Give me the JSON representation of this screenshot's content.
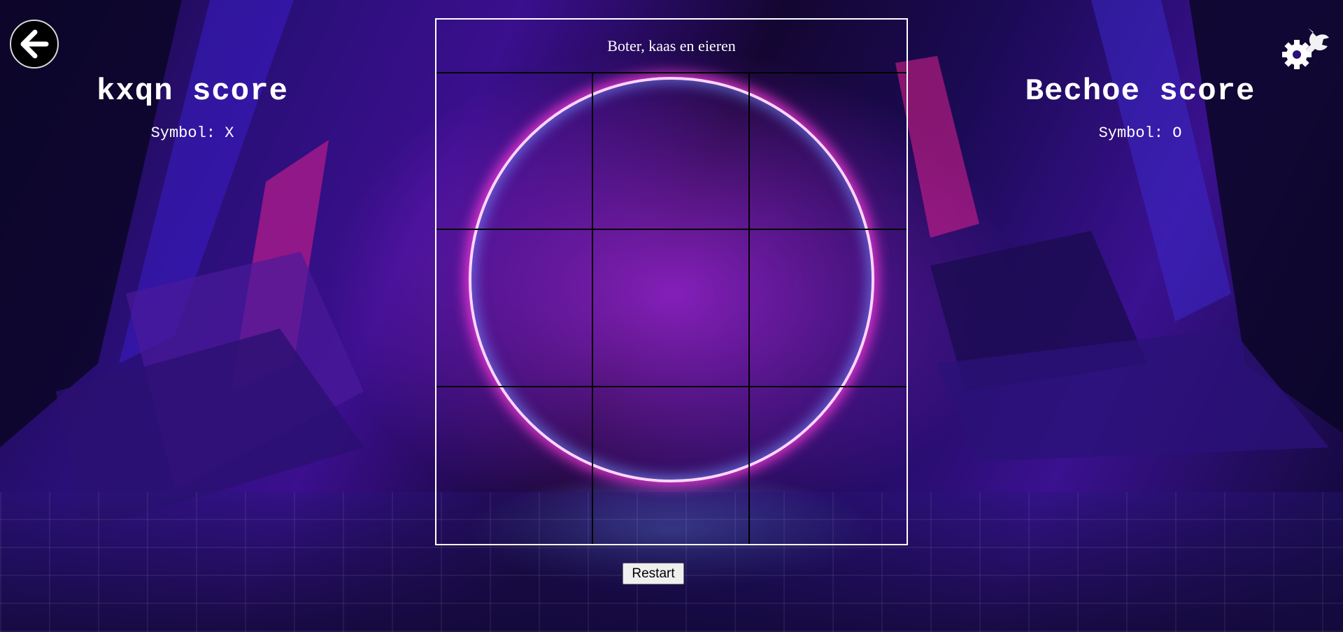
{
  "board": {
    "title": "Boter, kaas en eieren",
    "cells": [
      "",
      "",
      "",
      "",
      "",
      "",
      "",
      "",
      ""
    ]
  },
  "player1": {
    "name": "kxqn score",
    "symbol": "Symbol: X"
  },
  "player2": {
    "name": "Bechoe score",
    "symbol": "Symbol: O"
  },
  "controls": {
    "restart_label": "Restart",
    "back_icon": "arrow-left-icon",
    "settings_icon": "gear-wrench-icon"
  },
  "colors": {
    "board_border": "#ffffff",
    "grid_lines": "#000000",
    "text": "#ffffff"
  }
}
